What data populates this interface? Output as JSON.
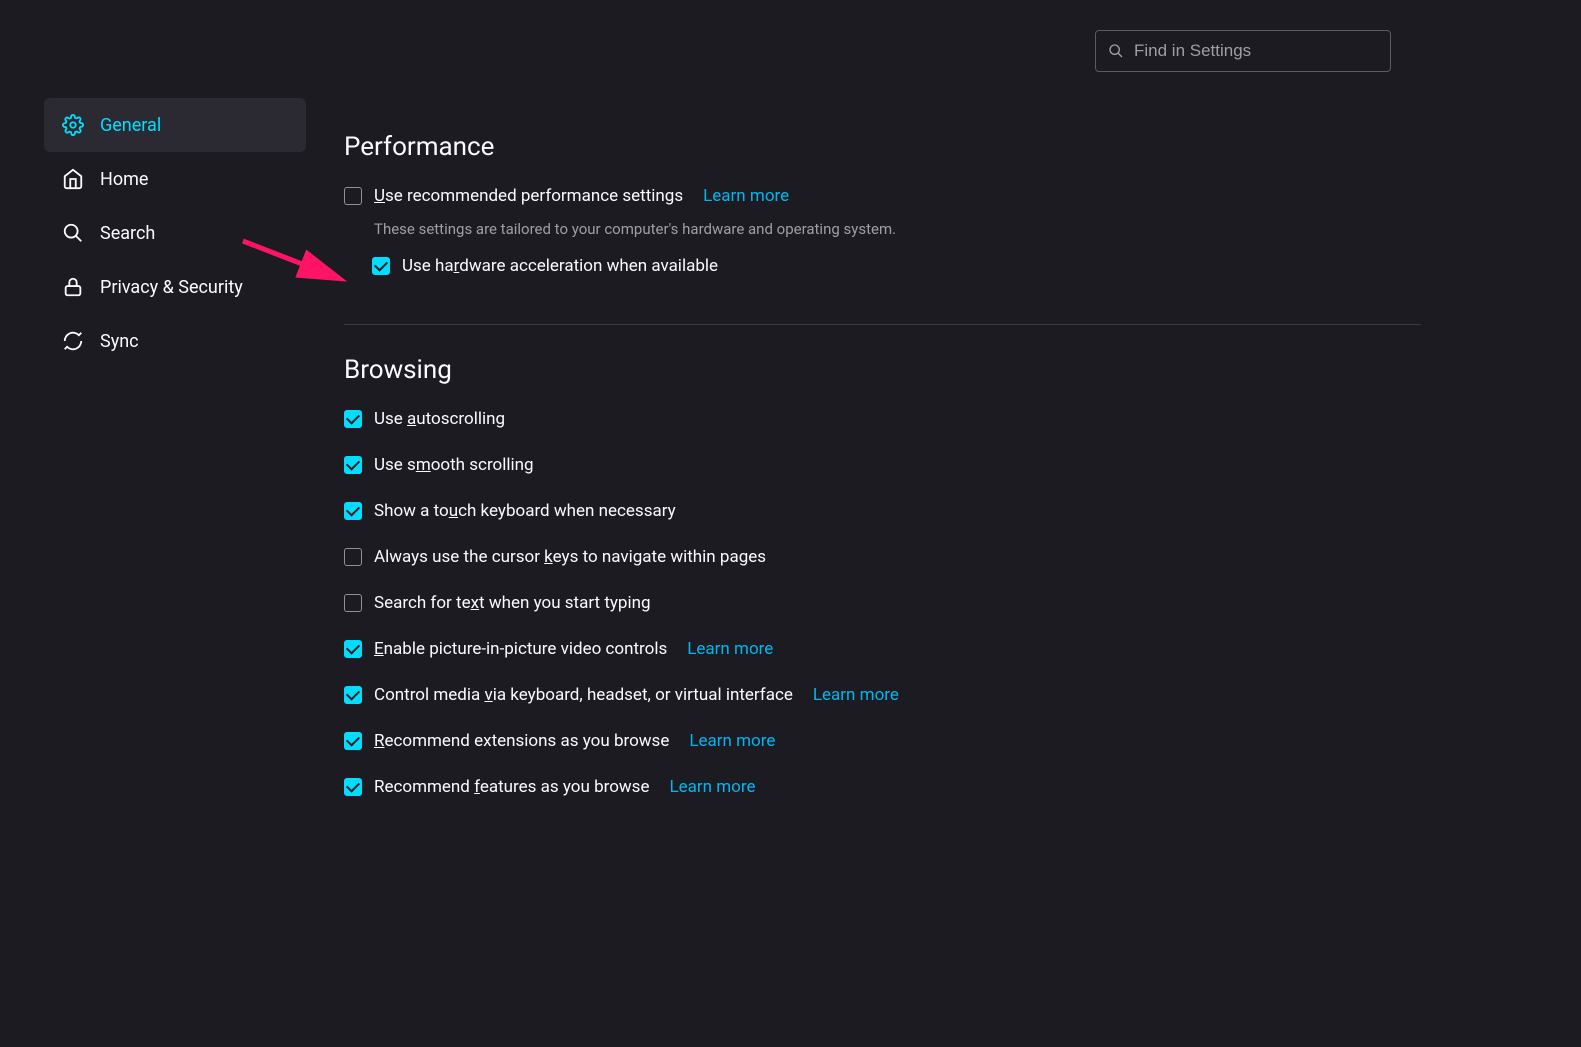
{
  "search": {
    "placeholder": "Find in Settings"
  },
  "sidebar": {
    "items": [
      {
        "label": "General"
      },
      {
        "label": "Home"
      },
      {
        "label": "Search"
      },
      {
        "label": "Privacy & Security"
      },
      {
        "label": "Sync"
      }
    ]
  },
  "performance": {
    "heading": "Performance",
    "recommended_pre": "U",
    "recommended_post": "se recommended performance settings",
    "learn_more": "Learn more",
    "desc": "These settings are tailored to your computer's hardware and operating system.",
    "hw_pre": "Use ha",
    "hw_u": "r",
    "hw_post": "dware acceleration when available"
  },
  "browsing": {
    "heading": "Browsing",
    "items": [
      {
        "checked": true,
        "pre": "Use ",
        "u": "a",
        "post": "utoscrolling",
        "link": ""
      },
      {
        "checked": true,
        "pre": "Use s",
        "u": "m",
        "post": "ooth scrolling",
        "link": ""
      },
      {
        "checked": true,
        "pre": "Show a to",
        "u": "u",
        "post": "ch keyboard when necessary",
        "link": ""
      },
      {
        "checked": false,
        "pre": "Always use the cursor ",
        "u": "k",
        "post": "eys to navigate within pages",
        "link": ""
      },
      {
        "checked": false,
        "pre": "Search for te",
        "u": "x",
        "post": "t when you start typing",
        "link": ""
      },
      {
        "checked": true,
        "pre": "",
        "u": "E",
        "post": "nable picture-in-picture video controls",
        "link": "Learn more"
      },
      {
        "checked": true,
        "pre": "Control media ",
        "u": "v",
        "post": "ia keyboard, headset, or virtual interface",
        "link": "Learn more"
      },
      {
        "checked": true,
        "pre": "",
        "u": "R",
        "post": "ecommend extensions as you browse",
        "link": "Learn more"
      },
      {
        "checked": true,
        "pre": "Recommend ",
        "u": "f",
        "post": "eatures as you browse",
        "link": "Learn more"
      }
    ]
  }
}
